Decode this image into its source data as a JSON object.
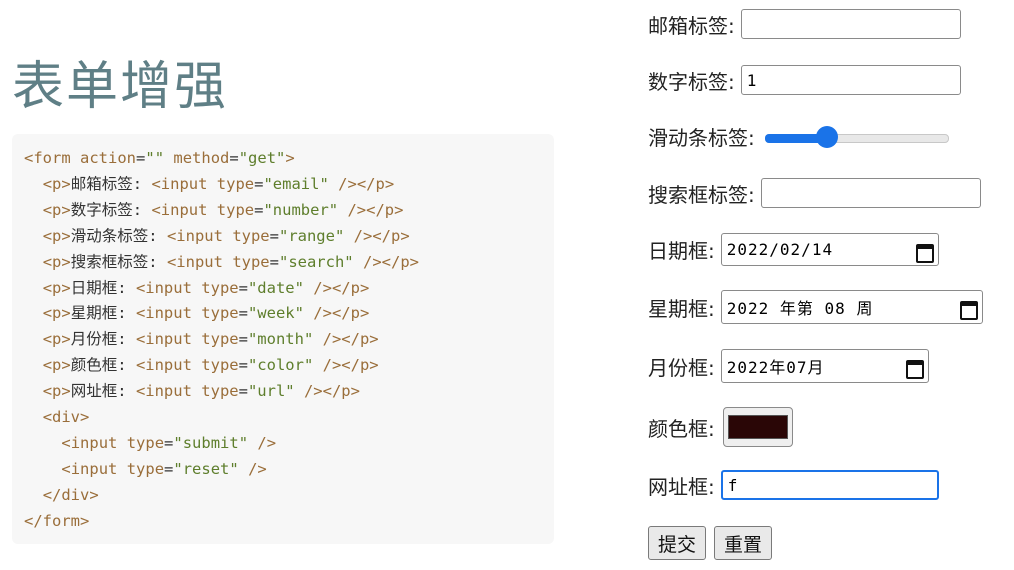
{
  "page_title": "表单增强",
  "code_lines": [
    "<form action=\"\" method=\"get\">",
    "  <p>邮箱标签: <input type=\"email\" /></p>",
    "  <p>数字标签: <input type=\"number\" /></p>",
    "  <p>滑动条标签: <input type=\"range\" /></p>",
    "  <p>搜索框标签: <input type=\"search\" /></p>",
    "  <p>日期框: <input type=\"date\" /></p>",
    "  <p>星期框: <input type=\"week\" /></p>",
    "  <p>月份框: <input type=\"month\" /></p>",
    "  <p>颜色框: <input type=\"color\" /></p>",
    "  <p>网址框: <input type=\"url\" /></p>",
    "  <div>",
    "    <input type=\"submit\" />",
    "    <input type=\"reset\" />",
    "  </div>",
    "</form>"
  ],
  "form": {
    "email": {
      "label": "邮箱标签:",
      "value": ""
    },
    "number": {
      "label": "数字标签:",
      "value": "1"
    },
    "range": {
      "label": "滑动条标签:",
      "value": 0.32
    },
    "search": {
      "label": "搜索框标签:",
      "value": ""
    },
    "date": {
      "label": "日期框:",
      "value": "2022/02/14"
    },
    "week": {
      "label": "星期框:",
      "value": "2022 年第 08 周"
    },
    "month": {
      "label": "月份框:",
      "value": "2022年07月"
    },
    "color": {
      "label": "颜色框:",
      "value": "#2a0606"
    },
    "url": {
      "label": "网址框:",
      "value": "f"
    },
    "submit_label": "提交",
    "reset_label": "重置"
  },
  "colors": {
    "accent": "#1a73e8",
    "title": "#5f7f86",
    "code_bg": "#f7f7f7"
  },
  "icons": {
    "calendar": "calendar-icon"
  }
}
